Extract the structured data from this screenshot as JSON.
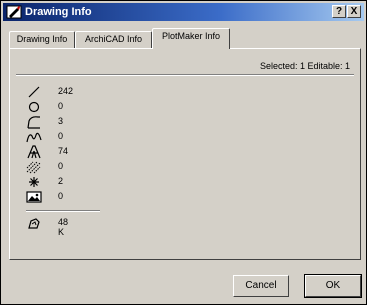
{
  "window": {
    "title": "Drawing Info"
  },
  "title_buttons": {
    "help": "?",
    "close": "X"
  },
  "tabs": [
    {
      "label": "Drawing Info"
    },
    {
      "label": "ArchiCAD Info"
    },
    {
      "label": "PlotMaker Info"
    }
  ],
  "active_tab": "PlotMaker Info",
  "selection_info": "Selected: 1 Editable: 1",
  "stats": [
    {
      "icon": "line-icon",
      "value": "242"
    },
    {
      "icon": "circle-icon",
      "value": "0"
    },
    {
      "icon": "arc-icon",
      "value": "3"
    },
    {
      "icon": "spline-icon",
      "value": "0"
    },
    {
      "icon": "text-icon",
      "value": "74"
    },
    {
      "icon": "hatch-icon",
      "value": "0"
    },
    {
      "icon": "hotspot-icon",
      "value": "2"
    },
    {
      "icon": "picture-icon",
      "value": "0"
    }
  ],
  "memory": {
    "icon": "memory-icon",
    "value": "48 K"
  },
  "buttons": {
    "cancel": "Cancel",
    "ok": "OK"
  }
}
